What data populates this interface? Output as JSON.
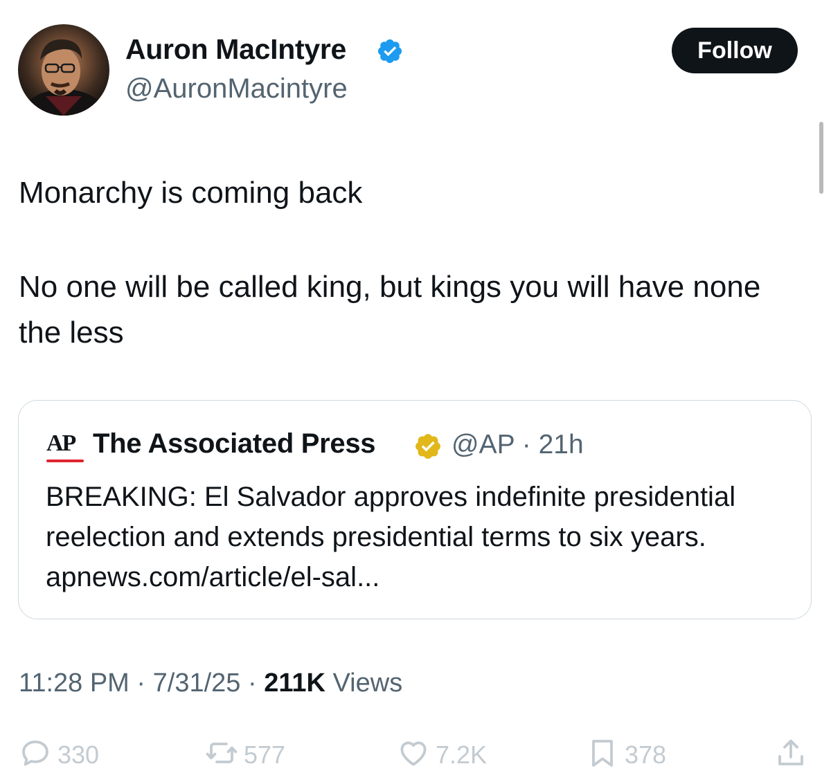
{
  "author": {
    "name": "Auron MacIntyre",
    "handle": "@AuronMacintyre"
  },
  "follow_label": "Follow",
  "tweet": {
    "paragraph1": "Monarchy is coming back",
    "paragraph2": "No one will be called king, but kings you will have none the less"
  },
  "quote": {
    "logo_text": "AP",
    "name": "The Associated Press",
    "handle_time": "@AP · 21h",
    "text": "BREAKING: El Salvador approves indefinite presidential reelection and extends presidential terms to six years. apnews.com/article/el-sal..."
  },
  "meta": {
    "time": "11:28 PM",
    "date": "7/31/25",
    "views_count": "211K",
    "views_label": "Views"
  },
  "actions": {
    "replies": "330",
    "reposts": "577",
    "likes": "7.2K",
    "bookmarks": "378"
  },
  "colors": {
    "verified_blue": "#1d9bf0",
    "verified_gold": "#e2b719",
    "ap_red": "#e0232f",
    "text_primary": "#0f1419",
    "text_secondary": "#536471"
  },
  "icons": [
    "verified-badge-icon",
    "gold-verified-badge-icon",
    "reply-icon",
    "repost-icon",
    "like-icon",
    "bookmark-icon",
    "share-icon"
  ]
}
